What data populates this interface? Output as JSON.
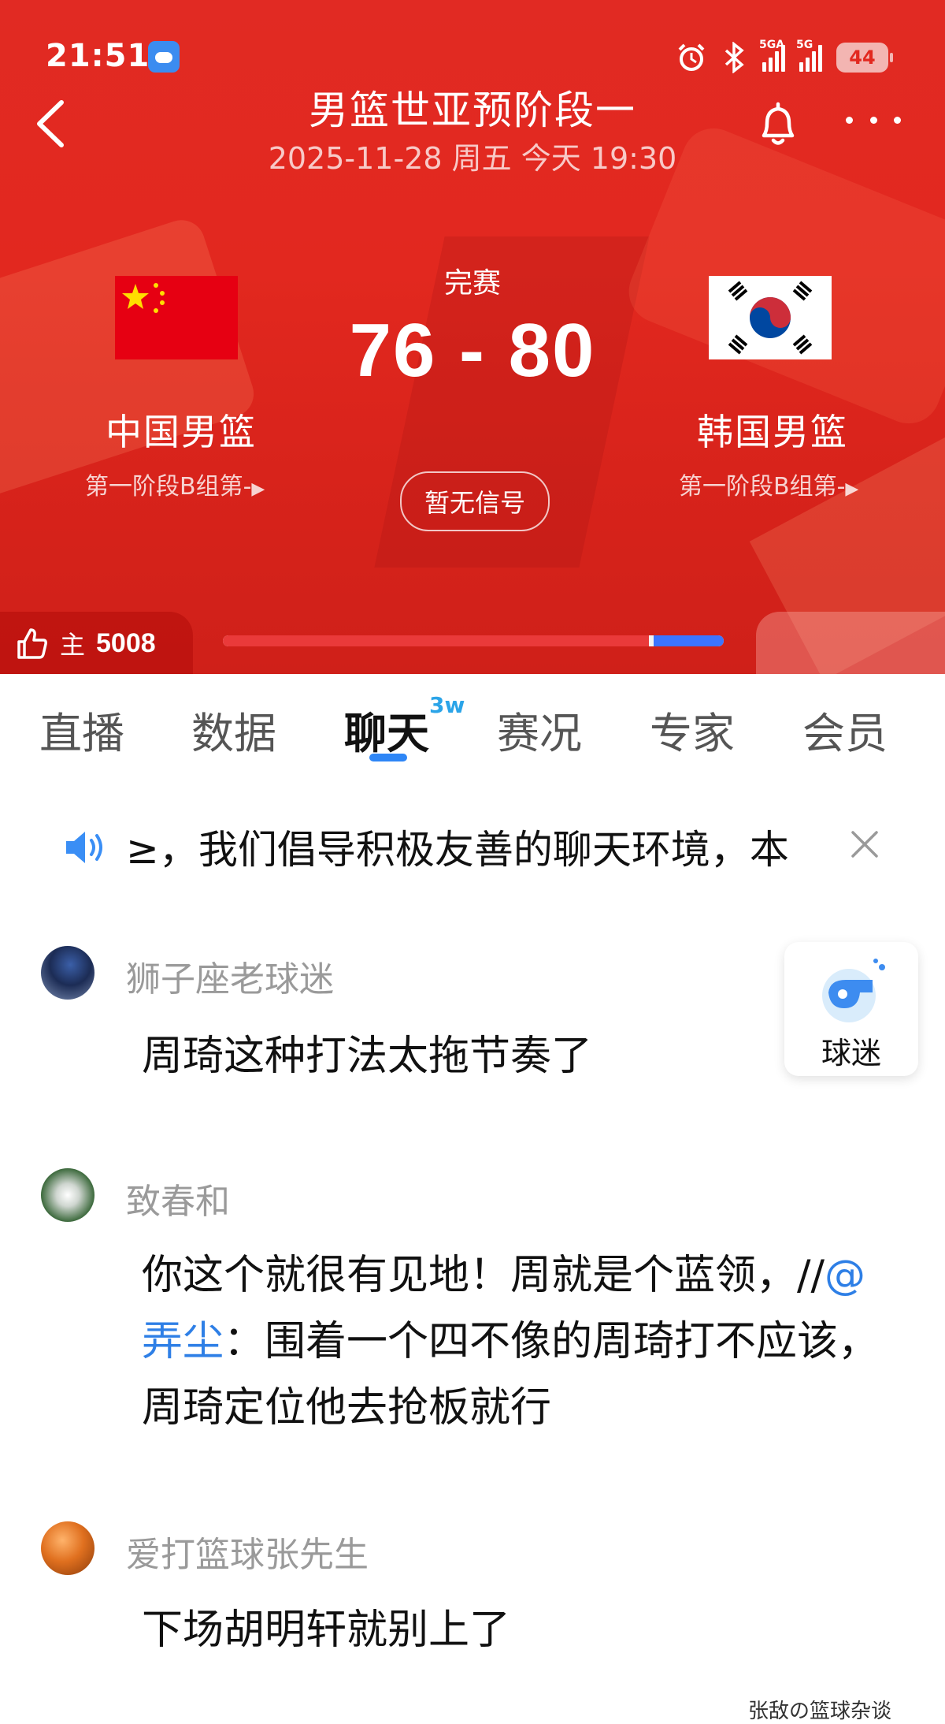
{
  "status_bar": {
    "time": "21:51",
    "signal1_tag": "5GA",
    "signal2_tag": "5G",
    "battery": "44"
  },
  "header": {
    "title": "男篮世亚预阶段一",
    "subtitle": "2025-11-28 周五 今天 19:30",
    "bg_color": "#e2281f"
  },
  "match": {
    "status": "完赛",
    "score": "76 - 80",
    "signal_label": "暂无信号",
    "home": {
      "name": "中国男篮",
      "sub": "第一阶段B组第-",
      "flag_icon": "china-flag-icon"
    },
    "away": {
      "name": "韩国男篮",
      "sub": "第一阶段B组第-",
      "flag_icon": "korea-flag-icon"
    }
  },
  "support": {
    "home_label": "主",
    "home_count": "5008",
    "home_share": 0.85,
    "home_color": "#ea3a3a",
    "away_color": "#3c74ff"
  },
  "tabs": [
    {
      "label": "直播"
    },
    {
      "label": "数据"
    },
    {
      "label": "聊天",
      "badge": "3w",
      "active": true
    },
    {
      "label": "赛况"
    },
    {
      "label": "专家"
    },
    {
      "label": "会员"
    }
  ],
  "notice": {
    "text": "≥，我们倡导积极友善的聊天环境，本"
  },
  "fan_button": {
    "label": "球迷"
  },
  "messages": [
    {
      "user": "狮子座老球迷",
      "text": "周琦这种打法太拖节奏了"
    },
    {
      "user": "致春和",
      "text_pre": "你这个就很有见地！周就是个蓝领，//",
      "mention": "@弄尘",
      "text_post": "：围着一个四不像的周琦打不应该，周琦定位他去抢板就行"
    },
    {
      "user": "爱打篮球张先生",
      "text": "下场胡明轩就别上了"
    }
  ],
  "bottom_clip": "张敌の篮球杂谈"
}
